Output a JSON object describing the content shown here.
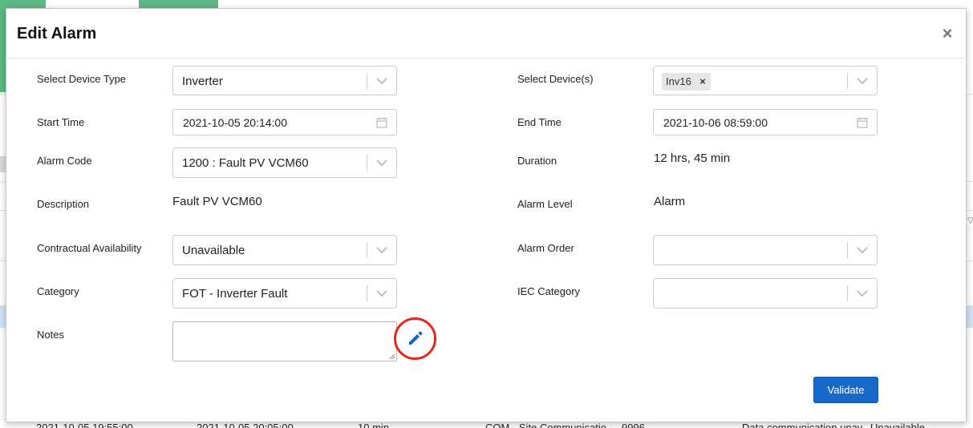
{
  "modal": {
    "title": "Edit Alarm",
    "close_symbol": "×",
    "validate_label": "Validate"
  },
  "form": {
    "device_type": {
      "label": "Select Device Type",
      "value": "Inverter"
    },
    "devices": {
      "label": "Select Device(s)",
      "chips": [
        "Inv16"
      ],
      "chip_remove": "×"
    },
    "start_time": {
      "label": "Start Time",
      "value": "2021-10-05 20:14:00"
    },
    "end_time": {
      "label": "End Time",
      "value": "2021-10-06 08:59:00"
    },
    "alarm_code": {
      "label": "Alarm Code",
      "value": "1200 : Fault PV VCM60"
    },
    "duration": {
      "label": "Duration",
      "value": "12 hrs, 45 min"
    },
    "description": {
      "label": "Description",
      "value": "Fault PV VCM60"
    },
    "alarm_level": {
      "label": "Alarm Level",
      "value": "Alarm"
    },
    "contractual_availability": {
      "label": "Contractual Availability",
      "value": "Unavailable"
    },
    "alarm_order": {
      "label": "Alarm Order",
      "value": ""
    },
    "category": {
      "label": "Category",
      "value": "FOT - Inverter Fault"
    },
    "iec_category": {
      "label": "IEC Category",
      "value": ""
    },
    "notes": {
      "label": "Notes",
      "value": ""
    }
  },
  "background_row": {
    "start": "2021-10-05 19:55:00",
    "end": "2021-10-05 20:05:00",
    "duration": "10 min",
    "code": "COM - Site Communicatio...",
    "num": "9996",
    "desc": "Data communication unav...",
    "availability": "Unavailable"
  },
  "icons": {
    "close": "close-icon",
    "chevron": "chevron-down-icon",
    "calendar": "calendar-icon",
    "edit": "pencil-icon"
  },
  "colors": {
    "accent_green": "#5db883",
    "primary_button": "#1668c9",
    "highlight_circle": "#e8261c",
    "selected_row": "#cfe3f7"
  }
}
